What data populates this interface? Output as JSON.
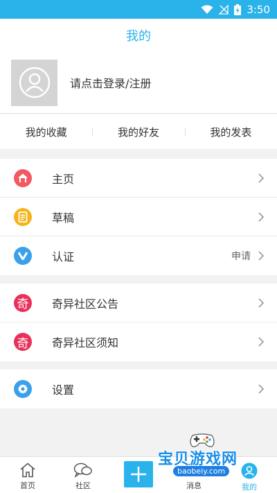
{
  "status_bar": {
    "time": "3:50"
  },
  "header": {
    "title": "我的"
  },
  "profile": {
    "login_prompt": "请点击登录/注册"
  },
  "quick_links": [
    "我的收藏",
    "我的好友",
    "我的发表"
  ],
  "menu_group_1": [
    {
      "label": "主页",
      "icon": "home-icon",
      "color": "#f25a61"
    },
    {
      "label": "草稿",
      "icon": "draft-icon",
      "color": "#f5b41c"
    },
    {
      "label": "认证",
      "icon": "verify-icon",
      "color": "#3aa0ea",
      "extra": "申请"
    }
  ],
  "menu_group_2": [
    {
      "label": "奇异社区公告",
      "icon": "qi-logo-icon",
      "badge_text": "奇"
    },
    {
      "label": "奇异社区须知",
      "icon": "qi-logo-icon",
      "badge_text": "奇"
    }
  ],
  "menu_group_3": [
    {
      "label": "设置",
      "icon": "settings-icon",
      "color": "#3aa0ea"
    }
  ],
  "tab_bar": [
    {
      "label": "首页",
      "icon": "home-outline-icon"
    },
    {
      "label": "社区",
      "icon": "chat-bubble-icon"
    },
    {
      "label": "",
      "icon": "plus-icon"
    },
    {
      "label": "消息",
      "icon": "message-icon"
    },
    {
      "label": "我的",
      "icon": "profile-icon",
      "active": true
    }
  ],
  "watermark": {
    "title": "宝贝游戏网",
    "url": "baobeiy.com"
  }
}
